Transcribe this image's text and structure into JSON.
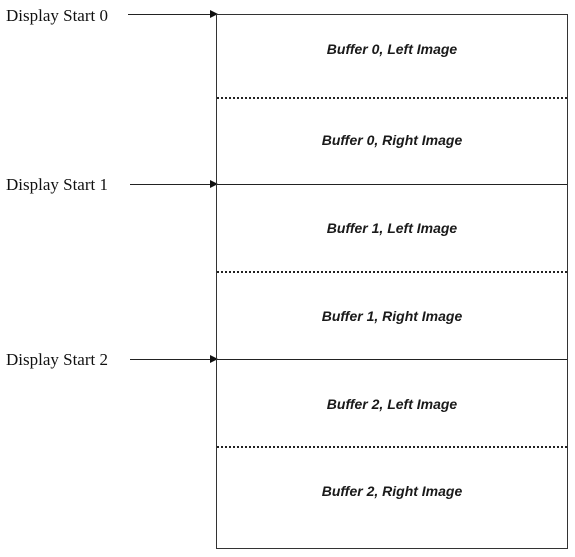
{
  "display_starts": [
    "Display Start 0",
    "Display Start 1",
    "Display Start 2"
  ],
  "buffers": [
    "Buffer 0, Left Image",
    "Buffer 0, Right Image",
    "Buffer 1, Left Image",
    "Buffer 1, Right Image",
    "Buffer 2, Left Image",
    "Buffer 2, Right Image"
  ]
}
